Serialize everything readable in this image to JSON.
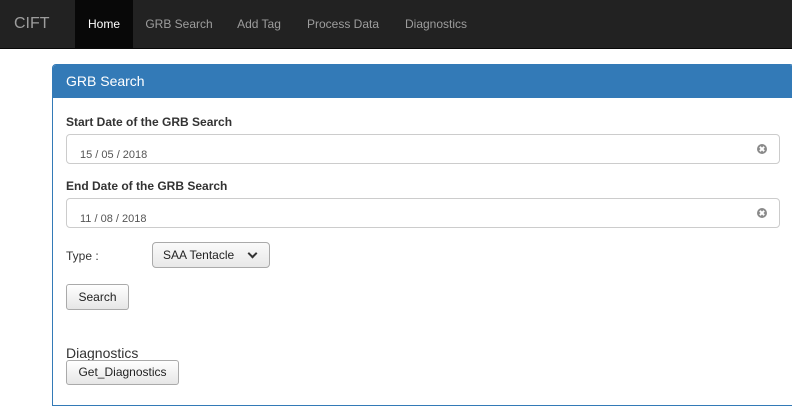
{
  "navbar": {
    "brand": "CIFT",
    "items": [
      {
        "label": "Home",
        "active": true
      },
      {
        "label": "GRB Search",
        "active": false
      },
      {
        "label": "Add Tag",
        "active": false
      },
      {
        "label": "Process Data",
        "active": false
      },
      {
        "label": "Diagnostics",
        "active": false
      }
    ]
  },
  "panel": {
    "title": "GRB Search",
    "start_label": "Start Date of the GRB Search",
    "start_value": "15 / 05 / 2018",
    "end_label": "End Date of the GRB Search",
    "end_value": "11 / 08 / 2018",
    "type_label": "Type :",
    "type_selected": "SAA Tentacle",
    "search_button": "Search",
    "diagnostics_title": "Diagnostics",
    "diagnostics_button": "Get_Diagnostics"
  },
  "colors": {
    "navbar_bg": "#222222",
    "nav_active_bg": "#080808",
    "panel_primary": "#337ab7"
  },
  "icons": [
    "clear-icon",
    "chevron-down-icon"
  ]
}
